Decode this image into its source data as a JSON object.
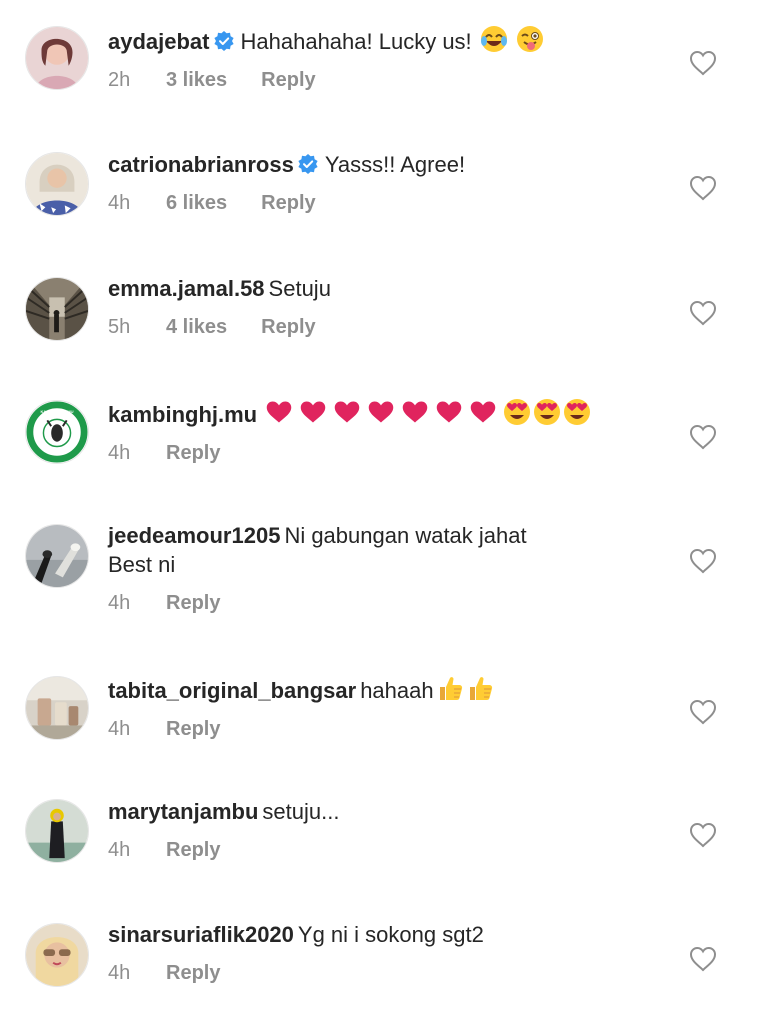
{
  "comments": [
    {
      "username": "aydajebat",
      "verified": true,
      "text": "Hahahahaha! Lucky us!",
      "emoji": [
        "face-with-tears-of-joy",
        "winking-face-with-tongue"
      ],
      "time": "2h",
      "likes": "3 likes",
      "reply": "Reply"
    },
    {
      "username": "catrionabrianross",
      "verified": true,
      "text": "Yasss!! Agree!",
      "emoji": [],
      "time": "4h",
      "likes": "6 likes",
      "reply": "Reply"
    },
    {
      "username": "emma.jamal.58",
      "verified": false,
      "text": "Setuju",
      "emoji": [],
      "time": "5h",
      "likes": "4 likes",
      "reply": "Reply"
    },
    {
      "username": "kambinghj.mu",
      "verified": false,
      "text": "",
      "emoji": [
        "red-heart",
        "red-heart",
        "red-heart",
        "red-heart",
        "red-heart",
        "red-heart",
        "red-heart",
        "heart-eyes",
        "heart-eyes",
        "heart-eyes"
      ],
      "time": "4h",
      "likes": "",
      "reply": "Reply"
    },
    {
      "username": "jeedeamour1205",
      "verified": false,
      "text": "Ni gabungan watak jahat",
      "text_line2": "Best ni",
      "emoji": [],
      "time": "4h",
      "likes": "",
      "reply": "Reply"
    },
    {
      "username": "tabita_original_bangsar",
      "verified": false,
      "text": "hahaah",
      "emoji": [
        "thumbs-up",
        "thumbs-up"
      ],
      "time": "4h",
      "likes": "",
      "reply": "Reply"
    },
    {
      "username": "marytanjambu",
      "verified": false,
      "text": "setuju...",
      "emoji": [],
      "time": "4h",
      "likes": "",
      "reply": "Reply"
    },
    {
      "username": "sinarsuriaflik2020",
      "verified": false,
      "text": "Yg ni i sokong sgt2",
      "emoji": [],
      "time": "4h",
      "likes": "",
      "reply": "Reply"
    }
  ],
  "colors": {
    "text": "#262626",
    "meta": "#8e8e8e",
    "verified": "#3897f0",
    "heart_outline": "#8e8e8e",
    "background": "#ffffff"
  },
  "avatar_kambing_text": "KAMBING HJ.MU"
}
